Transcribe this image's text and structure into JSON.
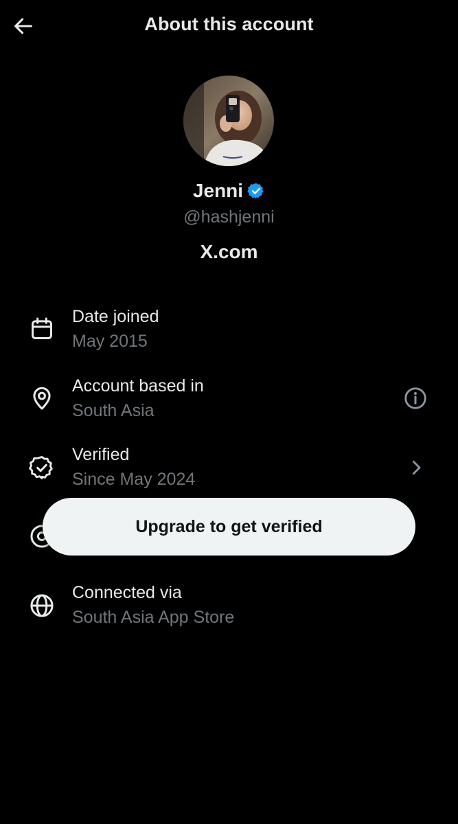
{
  "header": {
    "title": "About this account",
    "back_icon": "arrow-left-icon"
  },
  "profile": {
    "display_name": "Jenni",
    "handle": "@hashjenni",
    "site": "X.com",
    "verified_color": "#1d9bf0"
  },
  "rows": [
    {
      "label": "Date joined",
      "value": "May 2015",
      "icon": "calendar-icon"
    },
    {
      "label": "Account based in",
      "value": "South Asia",
      "icon": "location-pin-icon",
      "action_icon": "info-icon"
    },
    {
      "label": "Verified",
      "value": "Since May 2024",
      "icon": "verified-check-icon",
      "action_icon": "chevron-right-icon"
    },
    {
      "icon": "at-sign-icon"
    },
    {
      "label": "Connected via",
      "value": "South Asia App Store",
      "icon": "globe-icon"
    }
  ],
  "upgrade_button": {
    "label": "Upgrade to get verified"
  },
  "colors": {
    "background": "#000000",
    "primary_text": "#e7e9ea",
    "secondary_text": "#71767b",
    "button_bg": "#eff3f4",
    "button_text": "#0f1419"
  }
}
